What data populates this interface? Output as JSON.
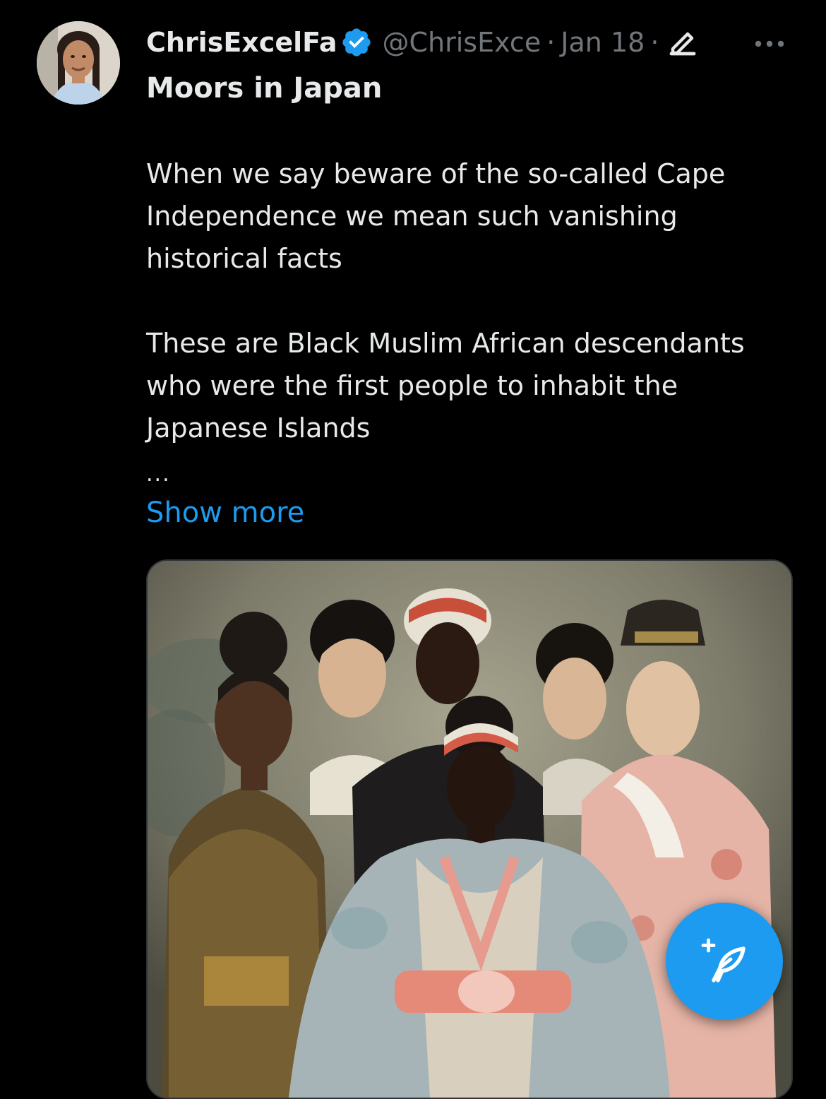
{
  "tweet": {
    "author": {
      "display_name": "ChrisExcelFa",
      "handle": "@ChrisExce",
      "verified": true
    },
    "date": "Jan 18",
    "separator": "·",
    "title": "Moors in Japan",
    "paragraphs": [
      "When we say beware of the so-called Cape Independence we mean such vanishing historical facts",
      "These are Black Muslim African descendants who were the first people to inhabit the Japanese Islands"
    ],
    "truncation": "...",
    "show_more_label": "Show more"
  },
  "icons": {
    "verified": "verified-badge-icon",
    "edit": "edit-pencil-icon",
    "more": "more-dots-icon",
    "compose": "compose-feather-plus-icon"
  },
  "colors": {
    "background": "#000000",
    "text_primary": "#e7e9ea",
    "text_secondary": "#71767b",
    "accent": "#1d9bf0",
    "border": "#2f3336"
  }
}
